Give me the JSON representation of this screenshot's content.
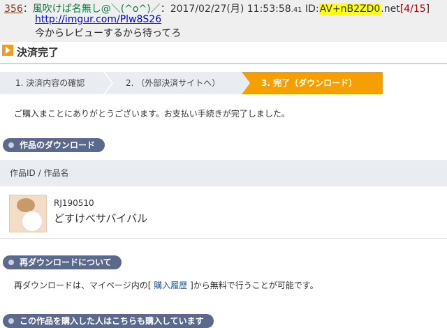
{
  "post": {
    "number": "356",
    "name": "風吹けば名無し@＼(^o^)／",
    "date": "2017/02/27(月) 11:53:58",
    "millis": ".41",
    "id_prefix": "ID:",
    "id_value": "AV+nB2ZD0",
    "id_suffix": ".net",
    "count": "[4/15]",
    "link": "http://imgur.com/Plw8S26",
    "body": "今からレビューするから待ってろ"
  },
  "page": {
    "title": "決済完了",
    "steps": [
      {
        "label": "1. 決済内容の確認",
        "active": false
      },
      {
        "label": "2. （外部決済サイトへ）",
        "active": false
      },
      {
        "label": "3. 完了（ダウンロード）",
        "active": true
      }
    ],
    "thanks": "ご購入まことにありがとうございます。お支払い手続きが完了しました。"
  },
  "download_section": {
    "heading": "作品のダウンロード",
    "column_header": "作品ID / 作品名",
    "work": {
      "id": "RJ190510",
      "name": "どすけべサバイバル"
    }
  },
  "redownload_section": {
    "heading": "再ダウンロードについて",
    "text_before": "再ダウンロードは、マイページ内の[ ",
    "link": "購入履歴",
    "text_after": " ]から無料で行うことが可能です。"
  },
  "bottom_section": {
    "heading": "この作品を購入した人はこちらも購入しています"
  },
  "colors": {
    "accent": "#f5a000",
    "pill": "#5b6a8c",
    "step_bg": "#e9edf2",
    "id_highlight": "#ffff00",
    "name_green": "#117743"
  }
}
